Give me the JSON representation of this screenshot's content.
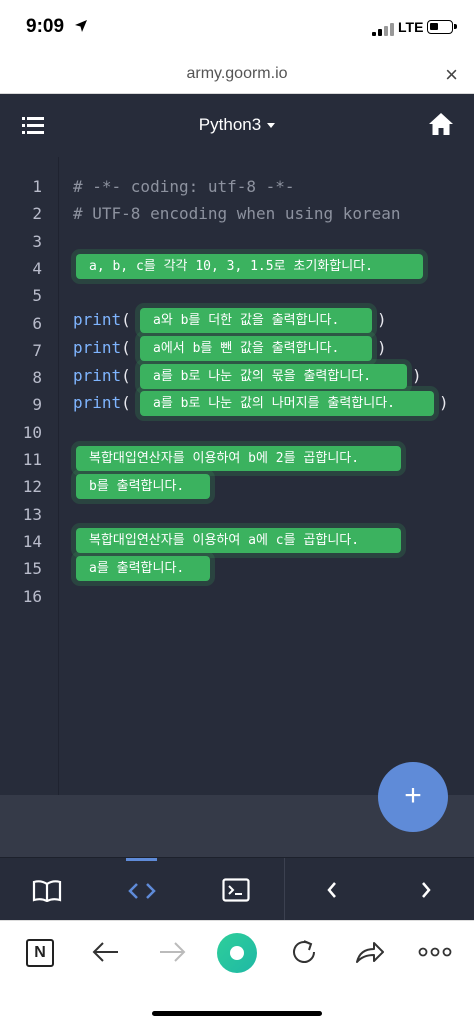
{
  "status_bar": {
    "time": "9:09",
    "network": "LTE"
  },
  "browser": {
    "url": "army.goorm.io",
    "close_label": "×"
  },
  "editor": {
    "language": "Python3"
  },
  "code_lines": [
    {
      "num": "1",
      "text": "# -*- coding: utf-8 -*-"
    },
    {
      "num": "2",
      "text": "# UTF-8 encoding when using korean"
    },
    {
      "num": "3",
      "text": ""
    },
    {
      "num": "4",
      "text": ""
    },
    {
      "num": "5",
      "text": ""
    },
    {
      "num": "6",
      "text": ""
    },
    {
      "num": "7",
      "text": ""
    },
    {
      "num": "8",
      "text": ""
    },
    {
      "num": "9",
      "text": ""
    },
    {
      "num": "10",
      "text": ""
    },
    {
      "num": "11",
      "text": ""
    },
    {
      "num": "12",
      "text": ""
    },
    {
      "num": "13",
      "text": ""
    },
    {
      "num": "14",
      "text": ""
    },
    {
      "num": "15",
      "text": ""
    },
    {
      "num": "16",
      "text": ""
    }
  ],
  "print_keyword": "print",
  "open_paren": "(",
  "close_paren": ")",
  "blanks": [
    "a, b, c를 각각 10, 3, 1.5로 초기화합니다.",
    "a와 b를 더한 값을 출력합니다.",
    "a에서 b를 뺀 값을 출력합니다.",
    "a를 b로 나눈 값의 몫을 출력합니다.",
    "a를 b로 나눈 값의 나머지를 출력합니다.",
    "복합대입연산자를 이용하여 b에 2를 곱합니다.",
    "b를 출력합니다.",
    "복합대입연산자를 이용하여 a에 c를 곱합니다.",
    "a를 출력합니다."
  ],
  "fab_label": "+",
  "bottom_bar": {
    "tab_button_label": "N"
  },
  "colors": {
    "accent": "#5f8bd8",
    "blank_green": "#3bb25f",
    "editor_bg": "#272c3a"
  }
}
